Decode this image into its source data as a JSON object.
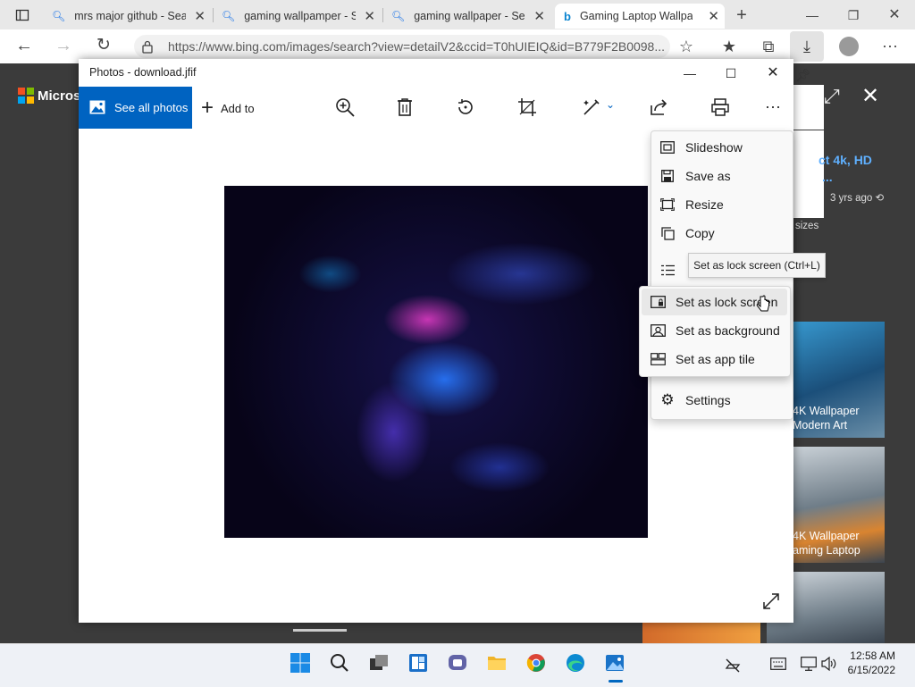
{
  "browser": {
    "tabs": [
      {
        "label": "mrs major github - Sear"
      },
      {
        "label": "gaming wallpamper - S"
      },
      {
        "label": "gaming wallpaper - Sea"
      },
      {
        "label": "Gaming Laptop Wallpa"
      }
    ],
    "url": "https://www.bing.com/images/search?view=detailV2&ccid=T0hUIEIQ&id=B779F2B0098..."
  },
  "background_page": {
    "brand": "Micros",
    "result_title": "ct 4k, HD",
    "result_sub": "...",
    "result_age": "3 yrs ago",
    "sizes_label": "sizes",
    "card1": [
      "4K Wallpaper",
      "Modern Art"
    ],
    "card2": [
      "4K Wallpaper",
      "aming Laptop"
    ]
  },
  "photos": {
    "title": "Photos - download.jfif",
    "see_all": "See all photos",
    "add_to": "Add to"
  },
  "menu": {
    "items": [
      "Slideshow",
      "Save as",
      "Resize",
      "Copy",
      "Settings"
    ],
    "tooltip": "Set as lock screen (Ctrl+L)",
    "submenu": [
      "Set as lock screen",
      "Set as background",
      "Set as app tile"
    ]
  },
  "taskbar": {
    "time": "12:58 AM",
    "date": "6/15/2022"
  }
}
